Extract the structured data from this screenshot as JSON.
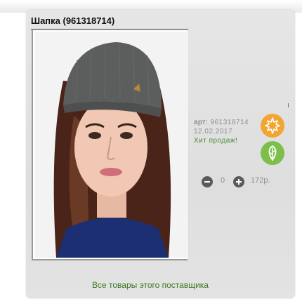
{
  "product": {
    "title": "Шапка (961318714)",
    "article_label": "арт:",
    "article_value": "961318714",
    "date": "12.02.2017",
    "hit_text": "Хит продаж!",
    "quantity": "0",
    "price": "172р."
  },
  "badges": [
    {
      "icon": "maple-leaf-icon",
      "color": "#f2a531"
    },
    {
      "icon": "leaf-icon",
      "color": "#7cc04b"
    }
  ],
  "footer": {
    "all_products_link": "Все товары этого поставщика"
  },
  "colors": {
    "link_green": "#3c7a22",
    "hit_green": "#4d8a2f"
  }
}
